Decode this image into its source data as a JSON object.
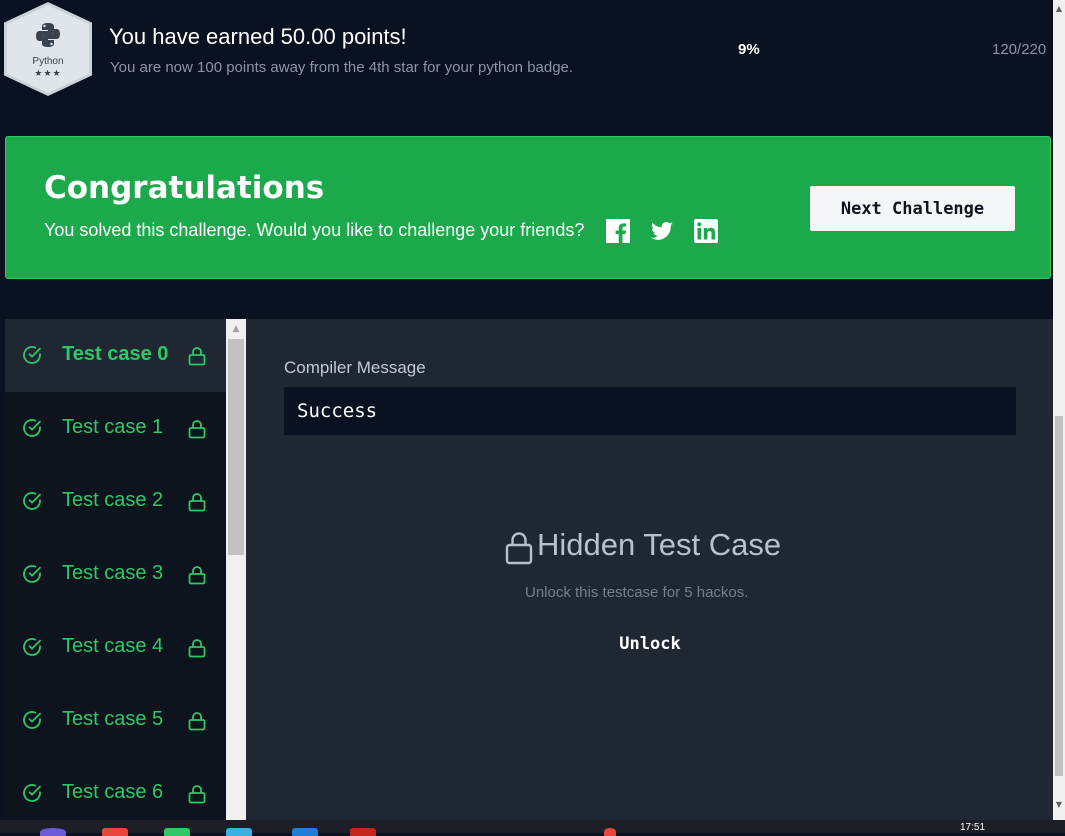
{
  "badge": {
    "name": "Python",
    "stars": "★★★"
  },
  "earned": {
    "title": "You have earned 50.00 points!",
    "subtitle": "You are now 100 points away from the 4th star for your python badge.",
    "percent": "9%",
    "progress": "120/220"
  },
  "congrats": {
    "title": "Congratulations",
    "text": "You solved this challenge. Would you like to challenge your friends?",
    "next_label": "Next Challenge"
  },
  "test_cases": [
    {
      "label": "Test case 0",
      "active": true
    },
    {
      "label": "Test case 1"
    },
    {
      "label": "Test case 2"
    },
    {
      "label": "Test case 3"
    },
    {
      "label": "Test case 4"
    },
    {
      "label": "Test case 5"
    },
    {
      "label": "Test case 6"
    }
  ],
  "compiler": {
    "label": "Compiler Message",
    "message": "Success"
  },
  "hidden": {
    "title": "Hidden Test Case",
    "subtitle": "Unlock this testcase for 5 hackos.",
    "unlock_label": "Unlock"
  },
  "taskbar": {
    "clock": "17:51"
  },
  "colors": {
    "accent": "#1ba94c",
    "success_text": "#2ec866",
    "bg_dark": "#0a1120",
    "panel": "#1f2733"
  }
}
